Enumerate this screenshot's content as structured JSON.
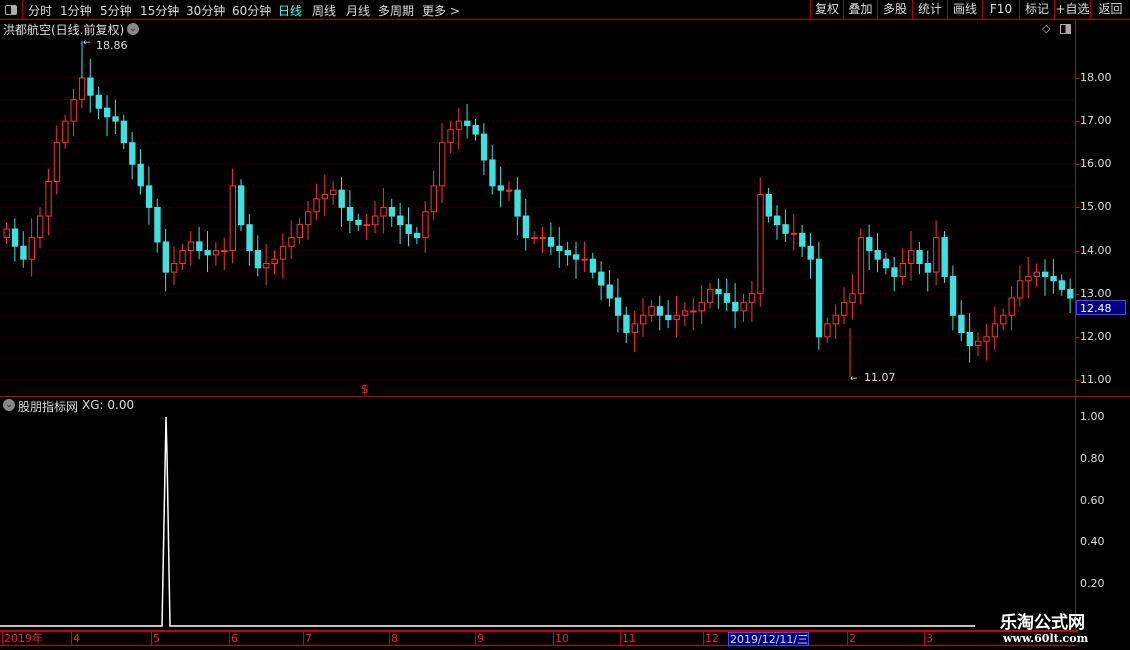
{
  "toolbar": {
    "periods": [
      "分时",
      "1分钟",
      "5分钟",
      "15分钟",
      "30分钟",
      "60分钟",
      "日线",
      "周线",
      "月线",
      "多周期",
      "更多 >"
    ],
    "active": "日线",
    "right_buttons": [
      "复权",
      "叠加",
      "多股",
      "统计",
      "画线",
      "F10",
      "标记",
      "+自选",
      "返回"
    ]
  },
  "main_panel": {
    "title": "洪都航空(日线.前复权)",
    "high_label": "18.86",
    "low_label": "11.07",
    "current_price": "12.48",
    "marker": "$",
    "y_axis": [
      "18.00",
      "17.00",
      "16.00",
      "15.00",
      "14.00",
      "13.00",
      "12.00",
      "11.00"
    ]
  },
  "indicator_panel": {
    "title": "股朋指标网",
    "value_label": "XG: 0.00",
    "y_axis": [
      "1.00",
      "0.80",
      "0.60",
      "0.40",
      "0.20"
    ]
  },
  "date_axis": [
    "2019年",
    "4",
    "5",
    "6",
    "7",
    "8",
    "9",
    "10",
    "11",
    "12",
    "2019/12/11/三",
    "2",
    "3"
  ],
  "watermark": {
    "name": "乐淘公式网",
    "url": "www.60lt.com"
  },
  "colors": {
    "up": "#ff3030",
    "down": "#40e0e0",
    "axis": "#cc0000",
    "highlight": "#000080"
  },
  "chart_data": {
    "type": "candlestick",
    "closes": [
      14.5,
      14.1,
      13.8,
      14.3,
      14.8,
      15.6,
      16.5,
      17.0,
      17.5,
      18.0,
      17.6,
      17.3,
      17.1,
      17.0,
      16.5,
      16.0,
      15.5,
      15.0,
      14.2,
      13.5,
      13.7,
      14.0,
      14.2,
      14.0,
      13.9,
      14.0,
      14.0,
      15.5,
      14.6,
      14.0,
      13.6,
      13.7,
      13.8,
      14.1,
      14.3,
      14.6,
      14.9,
      15.2,
      15.3,
      15.4,
      15.0,
      14.7,
      14.6,
      14.6,
      14.8,
      15.0,
      14.8,
      14.6,
      14.4,
      14.3,
      14.9,
      15.5,
      16.5,
      16.8,
      17.0,
      16.9,
      16.7,
      16.1,
      15.5,
      15.4,
      15.4,
      14.8,
      14.3,
      14.3,
      14.3,
      14.1,
      14.0,
      13.9,
      13.8,
      13.8,
      13.5,
      13.2,
      12.9,
      12.5,
      12.1,
      12.3,
      12.5,
      12.7,
      12.5,
      12.4,
      12.5,
      12.6,
      12.6,
      12.8,
      13.1,
      13.0,
      12.8,
      12.6,
      12.8,
      13.0,
      15.3,
      14.8,
      14.6,
      14.4,
      14.4,
      14.1,
      13.8,
      12.0,
      12.3,
      12.5,
      12.8,
      13.0,
      14.3,
      14.0,
      13.8,
      13.6,
      13.4,
      13.7,
      14.0,
      13.7,
      13.5,
      14.3,
      13.4,
      12.5,
      12.1,
      11.8,
      11.9,
      12.0,
      12.3,
      12.5,
      12.9,
      13.3,
      13.4,
      13.5,
      13.4,
      13.3,
      13.1,
      12.9
    ],
    "xg_values_note_free": [
      0,
      0,
      0,
      0,
      0,
      0,
      0,
      0,
      0,
      0,
      0,
      0,
      0,
      0,
      0,
      0,
      0,
      0,
      0,
      1,
      0
    ]
  }
}
